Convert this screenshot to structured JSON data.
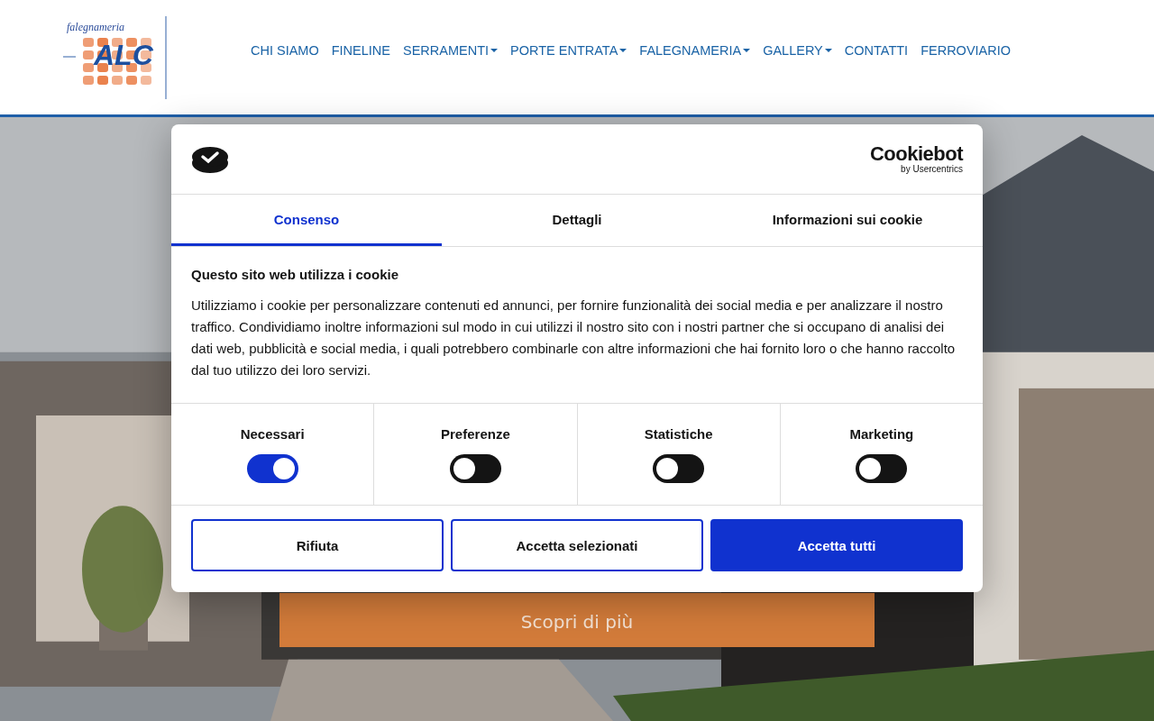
{
  "logo": {
    "tagline": "falegnameria",
    "name": "ALC"
  },
  "nav": [
    {
      "label": "CHI SIAMO",
      "dropdown": false
    },
    {
      "label": "FINELINE",
      "dropdown": false
    },
    {
      "label": "SERRAMENTI",
      "dropdown": true
    },
    {
      "label": "PORTE ENTRATA",
      "dropdown": true
    },
    {
      "label": "FALEGNAMERIA",
      "dropdown": true
    },
    {
      "label": "GALLERY",
      "dropdown": true
    },
    {
      "label": "CONTATTI",
      "dropdown": false
    },
    {
      "label": "FERROVIARIO",
      "dropdown": false
    }
  ],
  "hero": {
    "button": "Scopri di più"
  },
  "cookie_dialog": {
    "brand": {
      "name": "Cookiebot",
      "sub": "by Usercentrics"
    },
    "tabs": [
      {
        "label": "Consenso",
        "selected": true
      },
      {
        "label": "Dettagli",
        "selected": false
      },
      {
        "label": "Informazioni sui cookie",
        "selected": false
      }
    ],
    "title": "Questo sito web utilizza i cookie",
    "body": "Utilizziamo i cookie per personalizzare contenuti ed annunci, per fornire funzionalità dei social media e per analizzare il nostro traffico. Condividiamo inoltre informazioni sul modo in cui utilizzi il nostro sito con i nostri partner che si occupano di analisi dei dati web, pubblicità e social media, i quali potrebbero combinarle con altre informazioni che hai fornito loro o che hanno raccolto dal tuo utilizzo dei loro servizi.",
    "toggles": [
      {
        "label": "Necessari",
        "on": true
      },
      {
        "label": "Preferenze",
        "on": false
      },
      {
        "label": "Statistiche",
        "on": false
      },
      {
        "label": "Marketing",
        "on": false
      }
    ],
    "buttons": [
      {
        "label": "Rifiuta",
        "kind": "outline"
      },
      {
        "label": "Accetta selezionati",
        "kind": "outline"
      },
      {
        "label": "Accetta tutti",
        "kind": "primary"
      }
    ]
  }
}
